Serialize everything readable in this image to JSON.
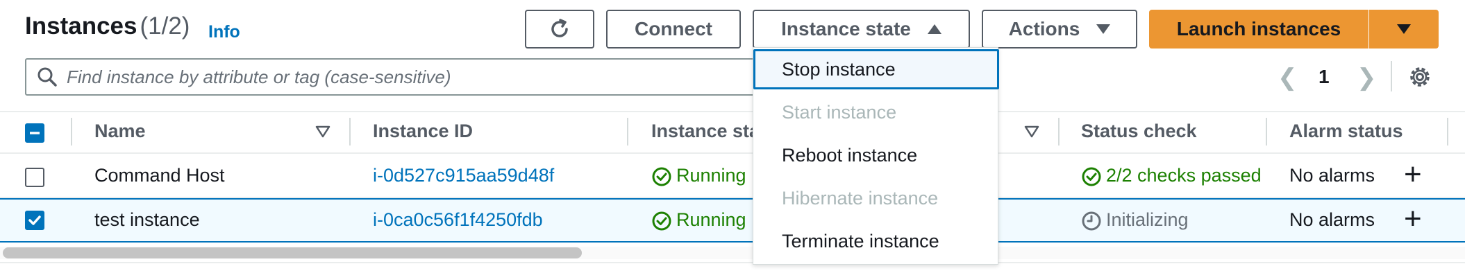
{
  "header": {
    "title": "Instances",
    "count": "(1/2)",
    "info": "Info"
  },
  "toolbar": {
    "refresh_icon": "refresh-icon",
    "connect": "Connect",
    "instance_state": "Instance state",
    "actions": "Actions",
    "launch": "Launch instances"
  },
  "search": {
    "placeholder": "Find instance by attribute or tag (case-sensitive)"
  },
  "pagination": {
    "page": "1"
  },
  "table": {
    "columns": [
      "Name",
      "Instance ID",
      "Instance sta",
      "Status check",
      "Alarm status"
    ],
    "rows": [
      {
        "name": "Command Host",
        "id": "i-0d527c915aa59d48f",
        "state": "Running",
        "status": "2/2 checks passed",
        "alarm": "No alarms",
        "selected": false
      },
      {
        "name": "test instance",
        "id": "i-0ca0c56f1f4250fdb",
        "state": "Running",
        "status": "Initializing",
        "alarm": "No alarms",
        "selected": true
      }
    ]
  },
  "menu": {
    "items": [
      {
        "label": "Stop instance",
        "disabled": false
      },
      {
        "label": "Start instance",
        "disabled": true
      },
      {
        "label": "Reboot instance",
        "disabled": false
      },
      {
        "label": "Hibernate instance",
        "disabled": true
      },
      {
        "label": "Terminate instance",
        "disabled": false
      }
    ]
  },
  "colors": {
    "accent": "#0073bb",
    "launch": "#ec9632",
    "success": "#1d8102"
  }
}
